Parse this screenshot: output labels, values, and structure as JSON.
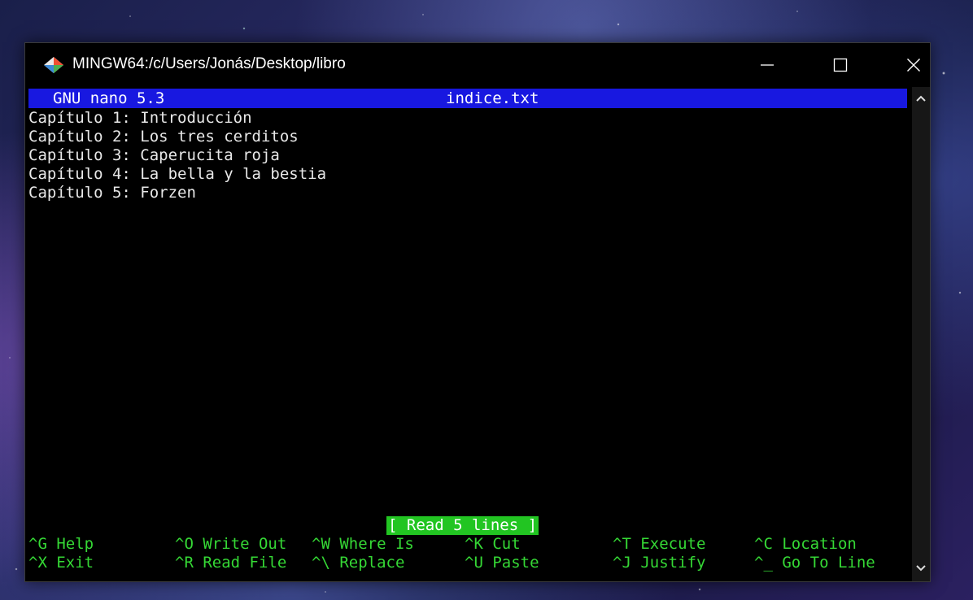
{
  "window": {
    "title": "MINGW64:/c/Users/Jonás/Desktop/libro"
  },
  "nano": {
    "version_label": "GNU nano 5.3",
    "filename": "indice.txt",
    "lines": [
      "Capítulo 1: Introducción",
      "Capítulo 2: Los tres cerditos",
      "Capítulo 3: Caperucita roja",
      "Capítulo 4: La bella y la bestia",
      "Capítulo 5: Forzen"
    ],
    "status_message": "[ Read 5 lines ]",
    "shortcuts_row1": [
      {
        "key": "^G",
        "label": "Help"
      },
      {
        "key": "^O",
        "label": "Write Out"
      },
      {
        "key": "^W",
        "label": "Where Is"
      },
      {
        "key": "^K",
        "label": "Cut"
      },
      {
        "key": "^T",
        "label": "Execute"
      },
      {
        "key": "^C",
        "label": "Location"
      }
    ],
    "shortcuts_row2": [
      {
        "key": "^X",
        "label": "Exit"
      },
      {
        "key": "^R",
        "label": "Read File"
      },
      {
        "key": "^\\",
        "label": "Replace"
      },
      {
        "key": "^U",
        "label": "Paste"
      },
      {
        "key": "^J",
        "label": "Justify"
      },
      {
        "key": "^_",
        "label": "Go To Line"
      }
    ]
  },
  "colors": {
    "header_bg": "#1818e0",
    "status_bg": "#22c522",
    "shortcut_fg": "#35d835"
  },
  "icons": {
    "app": "git-bash-diamond-icon",
    "minimize": "minimize-icon",
    "maximize": "maximize-icon",
    "close": "close-icon",
    "scroll_up": "chevron-up-icon",
    "scroll_down": "chevron-down-icon"
  }
}
